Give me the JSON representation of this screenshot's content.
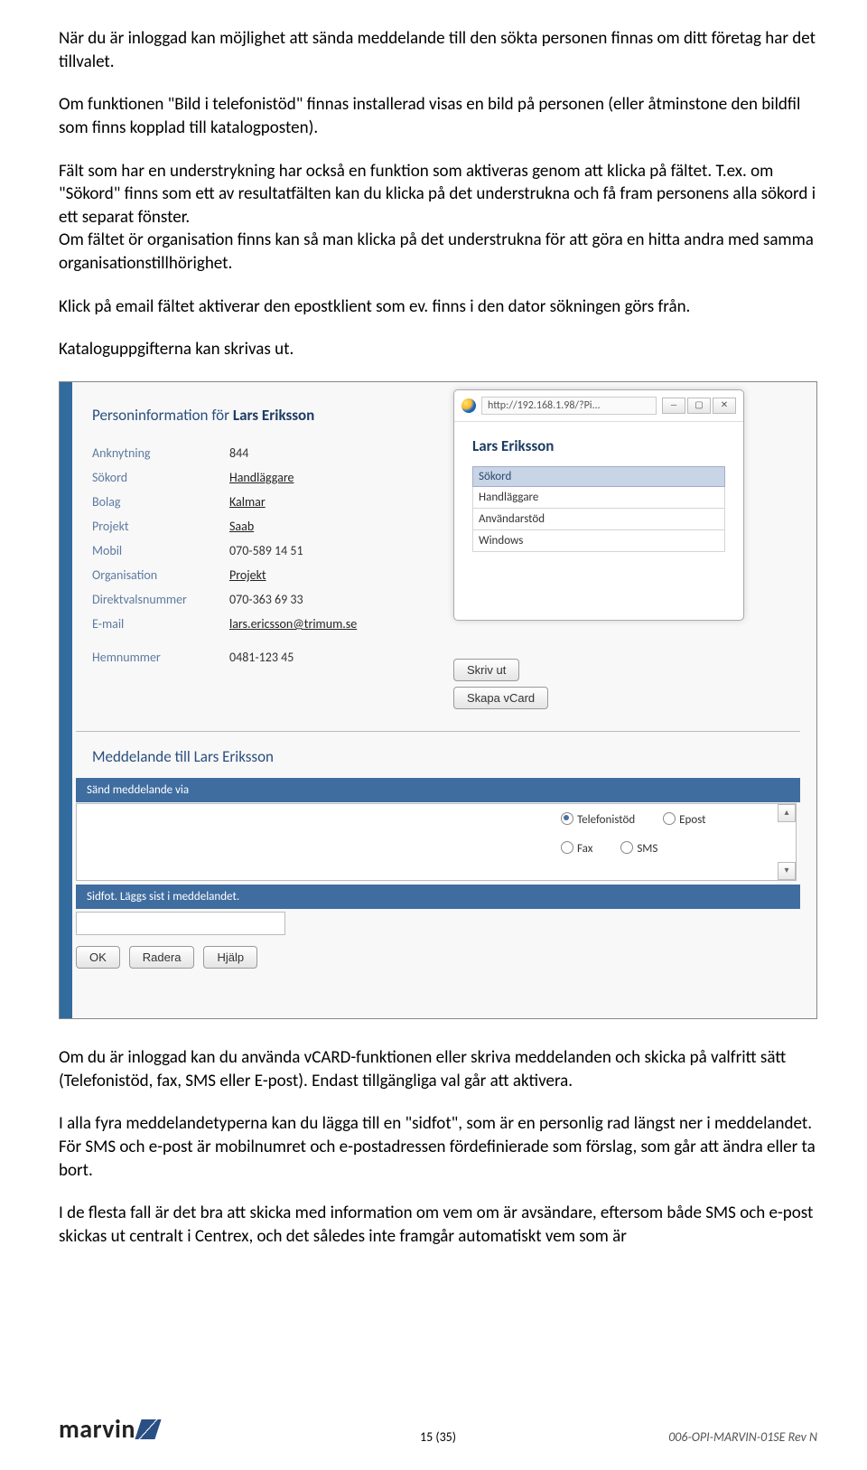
{
  "para1": "När du är inloggad kan möjlighet att sända meddelande till den sökta personen finnas om ditt företag har det tillvalet.",
  "para2": "Om funktionen \"Bild i telefonistöd\" finnas installerad visas en bild på personen (eller åtminstone den bildfil som finns kopplad till katalogposten).",
  "para3a": "Fält som har en understrykning har också en funktion som aktiveras genom att klicka på fältet. T.ex. om  \"Sökord\" finns som ett av resultatfälten kan du klicka på det understrukna  och få fram personens alla sökord i ett separat fönster.",
  "para3b": "Om fältet ör organisation finns kan så man klicka på det understrukna för att göra en hitta andra med samma organisationstillhörighet.",
  "para4": "Klick på email fältet aktiverar den epostklient som ev. finns i den dator sökningen görs från.",
  "para5": "Kataloguppgifterna kan skrivas ut.",
  "para6": "Om du är inloggad  kan du använda  vCARD-funktionen eller skriva meddelanden och skicka på valfritt sätt (Telefonistöd, fax, SMS eller E-post). Endast tillgängliga val går att aktivera.",
  "para7": "I alla fyra meddelandetyperna kan du lägga till en \"sidfot\", som är en personlig rad längst ner i meddelandet. För SMS och e-post är mobilnumret och e-postadressen fördefinierade som förslag, som går att ändra eller ta bort.",
  "para8": "I de flesta fall är det bra att skicka med information om vem om är avsändare, eftersom både SMS och e-post skickas ut centralt i Centrex, och det således inte framgår automatiskt vem som är",
  "personinfo": {
    "header_prefix": "Personinformation för ",
    "name": "Lars Eriksson",
    "rows": [
      {
        "label": "Anknytning",
        "value": "844",
        "ul": false
      },
      {
        "label": "Sökord",
        "value": "Handläggare",
        "ul": true
      },
      {
        "label": "Bolag",
        "value": "Kalmar",
        "ul": true
      },
      {
        "label": "Projekt",
        "value": "Saab",
        "ul": true
      },
      {
        "label": "Mobil",
        "value": "070-589 14 51",
        "ul": false
      },
      {
        "label": "Organisation",
        "value": "Projekt",
        "ul": true
      },
      {
        "label": "Direktvalsnummer",
        "value": "070-363 69 33",
        "ul": false
      },
      {
        "label": "E-mail",
        "value": "lars.ericsson@trimum.se",
        "ul": true
      },
      {
        "label": "Hemnummer",
        "value": "0481-123 45",
        "ul": false
      }
    ]
  },
  "popup": {
    "url": "http://192.168.1.98/?Pi...",
    "title": "Lars Eriksson",
    "heading": "Sökord",
    "items": [
      "Handläggare",
      "Användarstöd",
      "Windows"
    ]
  },
  "buttons": {
    "skriv_ut": "Skriv ut",
    "skapa_vcard": "Skapa vCard",
    "ok": "OK",
    "radera": "Radera",
    "hjalp": "Hjälp"
  },
  "message": {
    "heading_prefix": "Meddelande till ",
    "bar_send": "Sänd meddelande via",
    "bar_sidfot": "Sidfot. Läggs sist i meddelandet.",
    "radios": {
      "telefonistod": "Telefonistöd",
      "epost": "Epost",
      "fax": "Fax",
      "sms": "SMS"
    }
  },
  "footer": {
    "logo": "marvin",
    "page": "15 (35)",
    "docid": "006-OPI-MARVIN-01SE Rev N"
  }
}
